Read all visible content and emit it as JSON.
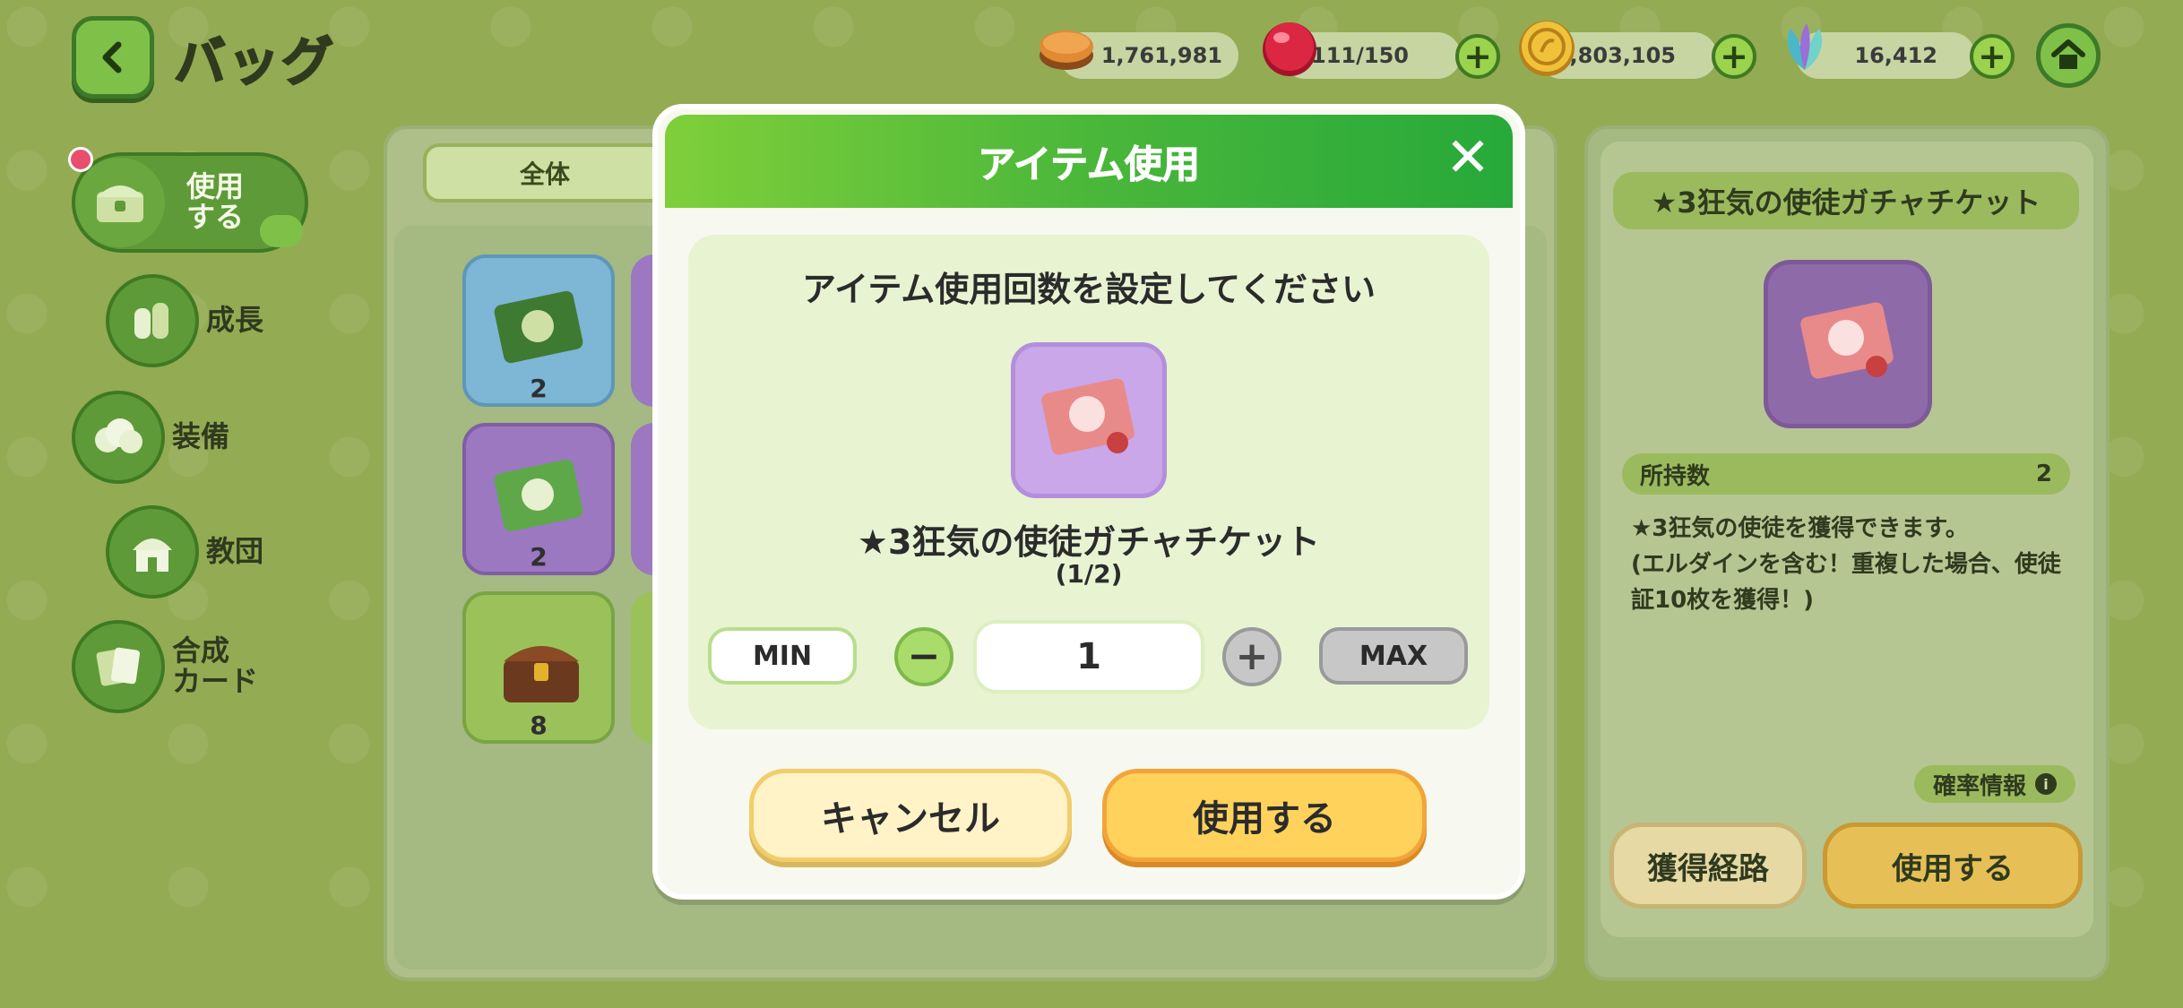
{
  "header": {
    "title": "バッグ",
    "resources": [
      {
        "name": "cookie-currency",
        "value": "1,761,981",
        "color": "#d9772a"
      },
      {
        "name": "red-orb-stamina",
        "value": "111/150",
        "color": "#d61f3c"
      },
      {
        "name": "gold-coin",
        "value": "1,803,105",
        "color": "#e4b12c"
      },
      {
        "name": "crystal-leaf",
        "value": "16,412",
        "color": "#67c9c9"
      }
    ]
  },
  "sidebar": {
    "items": [
      {
        "label": "使用\nする",
        "icon": "chest-icon",
        "active": true
      },
      {
        "label": "成長",
        "icon": "bottles-icon"
      },
      {
        "label": "装備",
        "icon": "wool-icon"
      },
      {
        "label": "教団",
        "icon": "temple-icon"
      },
      {
        "label": "合成\nカード",
        "icon": "cards-icon"
      }
    ]
  },
  "main": {
    "tab_all": "全体",
    "slots": [
      {
        "count": "2",
        "bg": "#7eb6d6",
        "icon": "green-ticket-icon"
      },
      {
        "count": "2",
        "bg": "#9b78c0",
        "icon": "clover-ticket-icon"
      },
      {
        "count": "8",
        "bg": "#9bc25a",
        "icon": "treasure-chest-icon"
      }
    ]
  },
  "detail": {
    "item_name": "★3狂気の使徒ガチャチケット",
    "owned_label": "所持数",
    "owned_value": "2",
    "description_line1": "★3狂気の使徒を獲得できます。",
    "description_line2": "(エルダインを含む！重複した場合、使徒証10枚を獲得！)",
    "prob_label": "確率情報",
    "acquire_button": "獲得経路",
    "use_button": "使用する"
  },
  "modal": {
    "title": "アイテム使用",
    "instruction": "アイテム使用回数を設定してください",
    "item_name": "★3狂気の使徒ガチャチケット",
    "fraction": "(1/2)",
    "min_label": "MIN",
    "max_label": "MAX",
    "quantity": "1",
    "cancel_label": "キャンセル",
    "use_label": "使用する"
  }
}
